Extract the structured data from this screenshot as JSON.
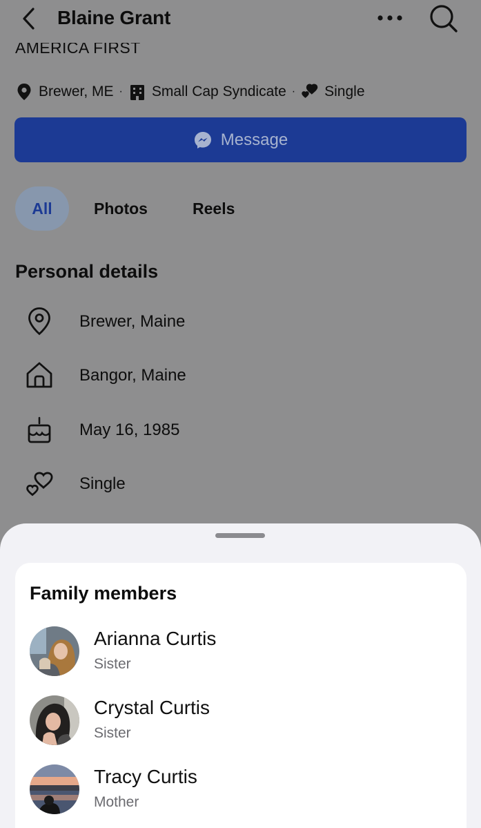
{
  "header": {
    "title": "Blaine Grant"
  },
  "profile": {
    "cut_title": "AMERICA FIRST",
    "meta": {
      "location": "Brewer, ME",
      "separator": "·",
      "work": "Small Cap Syndicate",
      "relationship": "Single"
    },
    "message_button": "Message",
    "tabs": [
      "All",
      "Photos",
      "Reels"
    ],
    "personal_details": {
      "title": "Personal details",
      "items": [
        {
          "icon": "location-pin-icon",
          "text": "Brewer, Maine"
        },
        {
          "icon": "home-icon",
          "text": "Bangor, Maine"
        },
        {
          "icon": "birthday-cake-icon",
          "text": "May 16, 1985"
        },
        {
          "icon": "hearts-icon",
          "text": "Single"
        }
      ]
    }
  },
  "family_sheet": {
    "title": "Family members",
    "members": [
      {
        "name": "Arianna Curtis",
        "relation": "Sister"
      },
      {
        "name": "Crystal Curtis",
        "relation": "Sister"
      },
      {
        "name": "Tracy Curtis",
        "relation": "Mother"
      }
    ]
  },
  "colors": {
    "scrim_background": "#8e8e8f",
    "message_button": "#1c3a94",
    "sheet_background": "#f2f2f6",
    "card_background": "#ffffff",
    "secondary_text": "#6b6b70"
  }
}
